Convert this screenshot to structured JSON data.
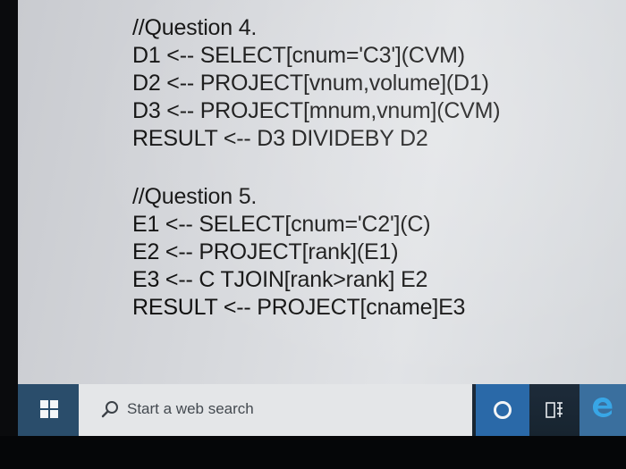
{
  "document": {
    "question4": {
      "heading": "//Question 4.",
      "lines": [
        "D1 <-- SELECT[cnum='C3'](CVM)",
        "D2 <-- PROJECT[vnum,volume](D1)",
        "D3 <-- PROJECT[mnum,vnum](CVM)",
        "RESULT <-- D3 DIVIDEBY D2"
      ]
    },
    "question5": {
      "heading": "//Question 5.",
      "lines": [
        "E1 <-- SELECT[cnum='C2'](C)",
        "E2 <-- PROJECT[rank](E1)",
        "E3 <-- C TJOIN[rank>rank] E2",
        "RESULT <-- PROJECT[cname]E3"
      ]
    }
  },
  "taskbar": {
    "start_icon": "windows-logo-icon",
    "search_icon": "search-icon",
    "search_placeholder": "Start a web search",
    "cortana_icon": "cortana-circle-icon",
    "taskview_icon": "task-view-icon",
    "edge_icon": "edge-browser-icon"
  },
  "colors": {
    "text": "#111111",
    "taskbar": "#1d2b3a",
    "start_button": "#2a4d6b",
    "cortana_button": "#2a69a8",
    "search_box": "#e4e6e8"
  }
}
